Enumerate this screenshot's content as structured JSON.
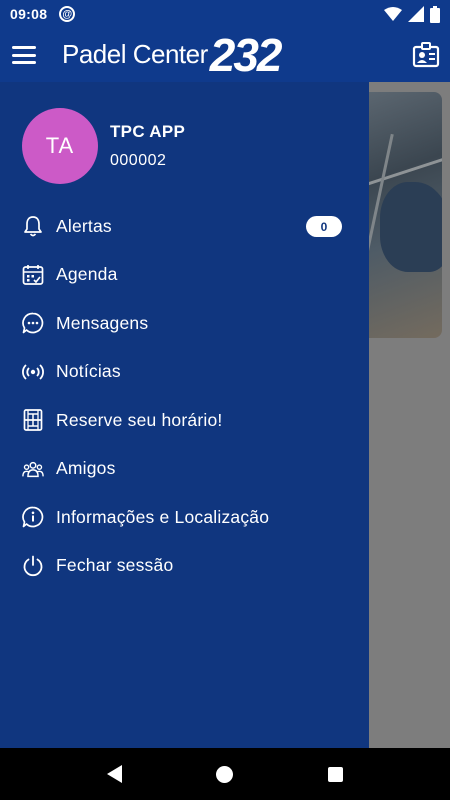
{
  "status_bar": {
    "time": "09:08",
    "at_glyph": "@",
    "icons": [
      "wifi-icon",
      "signal-icon",
      "battery-icon"
    ]
  },
  "app_bar": {
    "brand": "Padel Center",
    "brand_number": "232",
    "icons": [
      "menu-icon",
      "contact-card-icon"
    ]
  },
  "profile": {
    "initials": "TA",
    "name": "TPC APP",
    "id": "000002",
    "avatar_color": "#cc5ac7"
  },
  "menu": {
    "items": [
      {
        "label": "Alertas",
        "icon": "bell-icon",
        "badge": "0"
      },
      {
        "label": "Agenda",
        "icon": "calendar-icon"
      },
      {
        "label": "Mensagens",
        "icon": "chat-icon"
      },
      {
        "label": "Notícias",
        "icon": "broadcast-icon"
      },
      {
        "label": "Reserve seu horário!",
        "icon": "court-icon"
      },
      {
        "label": "Amigos",
        "icon": "friends-icon"
      },
      {
        "label": "Informações e Localização",
        "icon": "info-icon"
      },
      {
        "label": "Fechar sessão",
        "icon": "power-icon"
      }
    ]
  },
  "colors": {
    "primary": "#0f3a8c",
    "drawer": "#10367f",
    "accent": "#cc5ac7"
  },
  "nav_bar": {
    "icons": [
      "back-icon",
      "home-icon",
      "recents-icon"
    ]
  }
}
